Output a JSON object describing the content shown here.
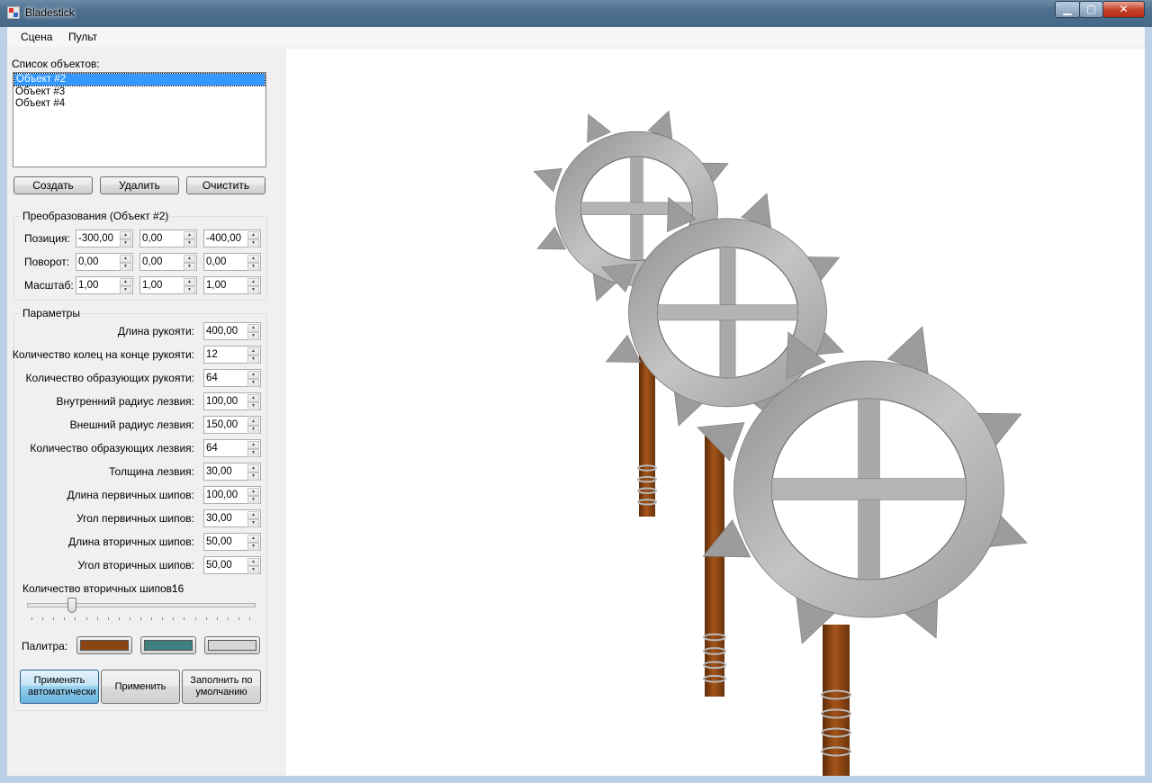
{
  "window": {
    "title": "Bladestick",
    "min_glyph": "▁",
    "max_glyph": "▢",
    "close_glyph": "✕"
  },
  "menu": {
    "items": [
      "Сцена",
      "Пульт"
    ]
  },
  "objects": {
    "label": "Список объектов:",
    "items": [
      "Объект #2",
      "Объект #3",
      "Объект #4"
    ],
    "selected": 0,
    "create": "Создать",
    "delete": "Удалить",
    "clear": "Очистить"
  },
  "transform": {
    "title": "Преобразования (Объект #2)",
    "rows": [
      {
        "label": "Позиция:",
        "values": [
          "-300,00",
          "0,00",
          "-400,00"
        ]
      },
      {
        "label": "Поворот:",
        "values": [
          "0,00",
          "0,00",
          "0,00"
        ]
      },
      {
        "label": "Масштаб:",
        "values": [
          "1,00",
          "1,00",
          "1,00"
        ]
      }
    ]
  },
  "params": {
    "title": "Параметры",
    "rows": [
      {
        "label": "Длина рукояти:",
        "value": "400,00"
      },
      {
        "label": "Количество колец на конце рукояти:",
        "value": "12"
      },
      {
        "label": "Количество образующих рукояти:",
        "value": "64"
      },
      {
        "label": "Внутренний радиус лезвия:",
        "value": "100,00"
      },
      {
        "label": "Внешний радиус лезвия:",
        "value": "150,00"
      },
      {
        "label": "Количество образующих лезвия:",
        "value": "64"
      },
      {
        "label": "Толщина лезвия:",
        "value": "30,00"
      },
      {
        "label": "Длина первичных шипов:",
        "value": "100,00"
      },
      {
        "label": "Угол первичных шипов:",
        "value": "30,00"
      },
      {
        "label": "Длина вторичных шипов:",
        "value": "50,00"
      },
      {
        "label": "Угол вторичных шипов:",
        "value": "50,00"
      }
    ],
    "secondary_label": "Количество вторичных шипов:",
    "secondary_value": "16",
    "slider_fraction": 0.2,
    "palette_label": "Палитра:",
    "palette": [
      "#8b4513",
      "#3e8080",
      "#d6d6d6"
    ],
    "auto_apply": "Применять автоматически",
    "apply": "Применить",
    "defaults": "Заполнить по умолчанию"
  },
  "colors": {
    "handle": "#8b4513",
    "blade": "#a9a9a9",
    "ring": "#b0b0b0",
    "band": "#b8b8b8"
  }
}
